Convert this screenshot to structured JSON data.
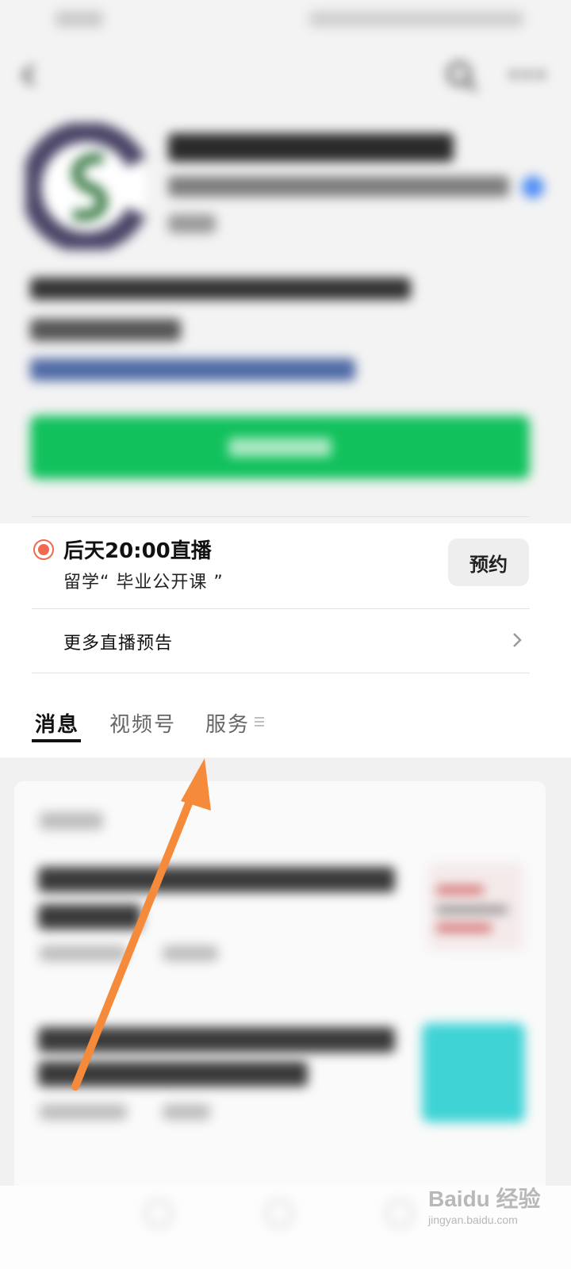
{
  "live": {
    "title": "后天20:00直播",
    "subtitle": "留学“ 毕业公开课 ”",
    "reserve_label": "预约",
    "more_label": "更多直播预告"
  },
  "tabs": [
    {
      "label": "消息",
      "active": true
    },
    {
      "label": "视频号",
      "active": false
    },
    {
      "label": "服务",
      "active": false
    }
  ],
  "colors": {
    "follow_green": "#11c15c",
    "live_red": "#f06a4d",
    "annotation_orange": "#f58a3b",
    "verify_blue": "#4f8df5"
  },
  "watermark": {
    "brand": "Baidu 经验",
    "url": "jingyan.baidu.com"
  }
}
